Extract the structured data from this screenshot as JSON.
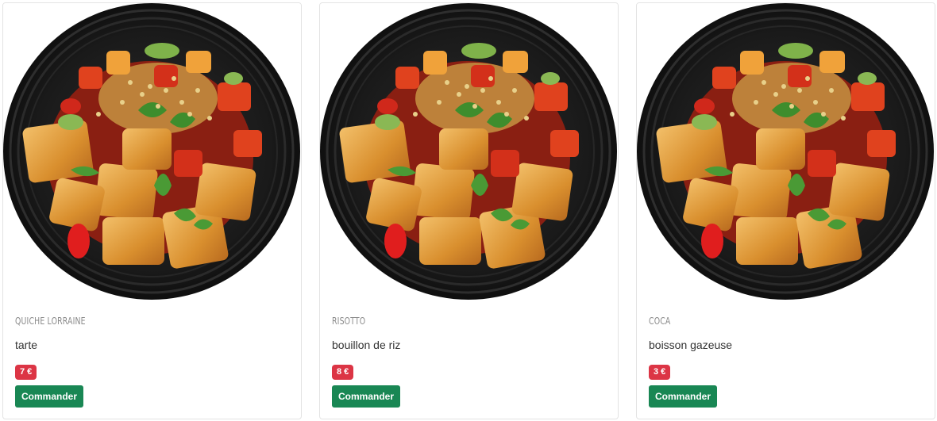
{
  "products": [
    {
      "title": "Quiche Lorraine",
      "description": "tarte",
      "price": "7 €",
      "button_label": "Commander"
    },
    {
      "title": "Risotto",
      "description": "bouillon de riz",
      "price": "8 €",
      "button_label": "Commander"
    },
    {
      "title": "Coca",
      "description": "boisson gazeuse",
      "price": "3 €",
      "button_label": "Commander"
    }
  ],
  "colors": {
    "price_badge": "#dc3545",
    "order_button": "#198754",
    "plate": "#1c1c1c"
  },
  "image_subject": "food-bowl-photo"
}
